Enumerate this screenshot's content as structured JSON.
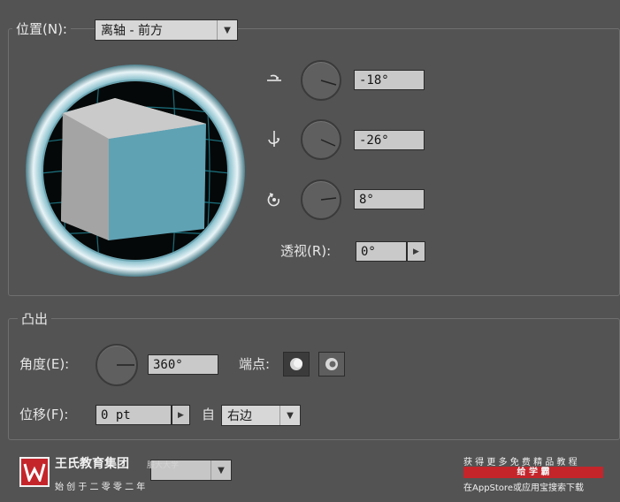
{
  "position": {
    "label": "位置(N):",
    "value": "离轴 - 前方"
  },
  "rotation": {
    "x_angle": "-18°",
    "y_angle": "-26°",
    "z_angle": "8°",
    "x_icon": "rotate-horizontal-axis-icon",
    "y_icon": "rotate-vertical-axis-icon",
    "z_icon": "rotate-z-axis-icon"
  },
  "perspective": {
    "label": "透视(R):",
    "value": "0°"
  },
  "extrude": {
    "section_title": "凸出",
    "angle_label": "角度(E):",
    "angle_value": "360°",
    "cap_label": "端点:",
    "offset_label": "位移(F):",
    "offset_value": "0 pt",
    "from_label": "自",
    "from_value": "右边"
  },
  "watermark": {
    "brand_line1": "王氏教育集团",
    "brand_small": "服大大学",
    "brand_line2": "始 创 于 二 零 零 二 年",
    "promo_line1": "获 得 更 多 免 费 精 品 教 程",
    "promo_highlight": "给 学 霸",
    "promo_line3": "在AppStore或应用宝搜索下载"
  },
  "colors": {
    "panel_bg": "#535353",
    "cube_front": "#5fa2b4",
    "cube_side": "#a3a3a3",
    "ring": "#8fc3cf",
    "brand_red": "#c4252b"
  }
}
